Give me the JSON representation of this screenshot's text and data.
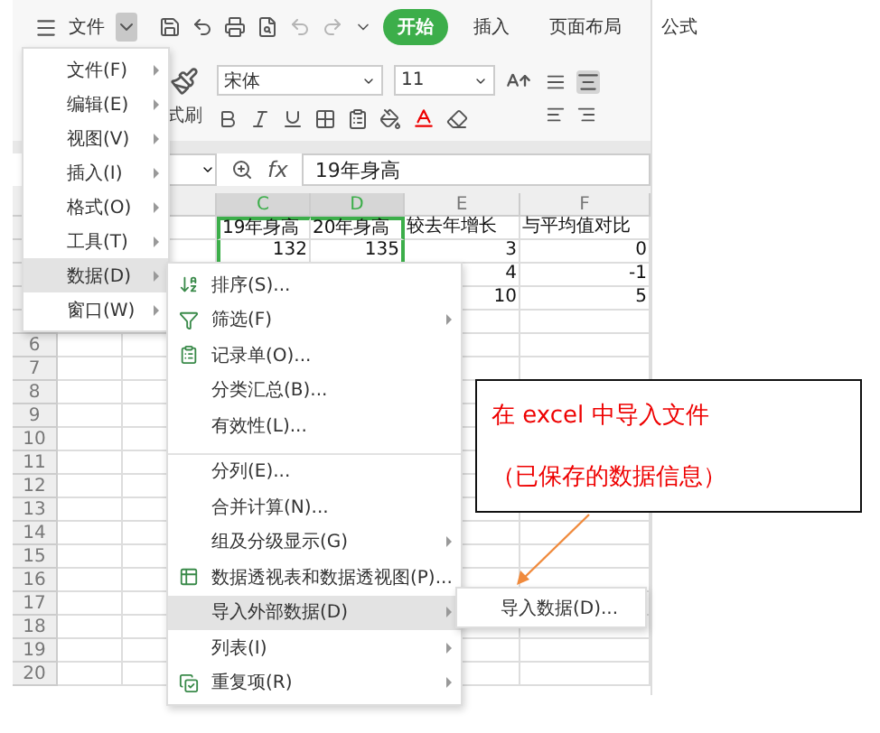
{
  "toolbar": {
    "file_label": "文件",
    "tabs": [
      {
        "label": "开始",
        "selected": true
      },
      {
        "label": "插入",
        "selected": false
      },
      {
        "label": "页面布局",
        "selected": false
      },
      {
        "label": "公式",
        "selected": false
      }
    ]
  },
  "ribbon": {
    "format_painter_label": "式刷",
    "font": "宋体",
    "font_size": "11"
  },
  "formula_bar": {
    "fx": "fx",
    "value": "19年身高"
  },
  "sheet": {
    "columns": [
      {
        "label": "C",
        "selected": true
      },
      {
        "label": "D",
        "selected": true
      },
      {
        "label": "E",
        "selected": false
      },
      {
        "label": "F",
        "selected": false
      }
    ],
    "data_rows": [
      {
        "cells": {
          "C": "19年身高",
          "D": "20年身高",
          "E": "较去年增长",
          "F": "与平均值对比"
        }
      },
      {
        "cells": {
          "C": "132",
          "D": "135",
          "E": "3",
          "F": "0"
        }
      },
      {
        "cells": {
          "E": "4",
          "F": "-1"
        }
      },
      {
        "cells": {
          "E": "10",
          "F": "5"
        }
      }
    ],
    "row_numbers": [
      "6",
      "7",
      "8",
      "9",
      "10",
      "11",
      "12",
      "13",
      "14",
      "15",
      "16",
      "17",
      "18",
      "19",
      "20"
    ]
  },
  "main_menu": [
    {
      "label": "文件(F)",
      "selected": false
    },
    {
      "label": "编辑(E)",
      "selected": false
    },
    {
      "label": "视图(V)",
      "selected": false
    },
    {
      "label": "插入(I)",
      "selected": false
    },
    {
      "label": "格式(O)",
      "selected": false
    },
    {
      "label": "工具(T)",
      "selected": false
    },
    {
      "label": "数据(D)",
      "selected": true
    },
    {
      "label": "窗口(W)",
      "selected": false
    }
  ],
  "data_menu": [
    {
      "label": "排序(S)...",
      "selected": false,
      "submenu": false,
      "separator_before": false
    },
    {
      "label": "筛选(F)",
      "selected": false,
      "submenu": true,
      "separator_before": false
    },
    {
      "label": "记录单(O)...",
      "selected": false,
      "submenu": false,
      "separator_before": false
    },
    {
      "label": "分类汇总(B)...",
      "selected": false,
      "submenu": false,
      "separator_before": false
    },
    {
      "label": "有效性(L)...",
      "selected": false,
      "submenu": false,
      "separator_before": false
    },
    {
      "label": "分列(E)...",
      "selected": false,
      "submenu": false,
      "separator_before": true
    },
    {
      "label": "合并计算(N)...",
      "selected": false,
      "submenu": false,
      "separator_before": false
    },
    {
      "label": "组及分级显示(G)",
      "selected": false,
      "submenu": true,
      "separator_before": false
    },
    {
      "label": "数据透视表和数据透视图(P)...",
      "selected": false,
      "submenu": false,
      "separator_before": false
    },
    {
      "label": "导入外部数据(D)",
      "selected": true,
      "submenu": true,
      "separator_before": false
    },
    {
      "label": "列表(I)",
      "selected": false,
      "submenu": true,
      "separator_before": false
    },
    {
      "label": "重复项(R)",
      "selected": false,
      "submenu": true,
      "separator_before": false
    }
  ],
  "import_menu": [
    {
      "label": "导入数据(D)...",
      "selected": false
    }
  ],
  "callout": {
    "lines": [
      "在 excel 中导入文件",
      "（已保存的数据信息）"
    ]
  }
}
